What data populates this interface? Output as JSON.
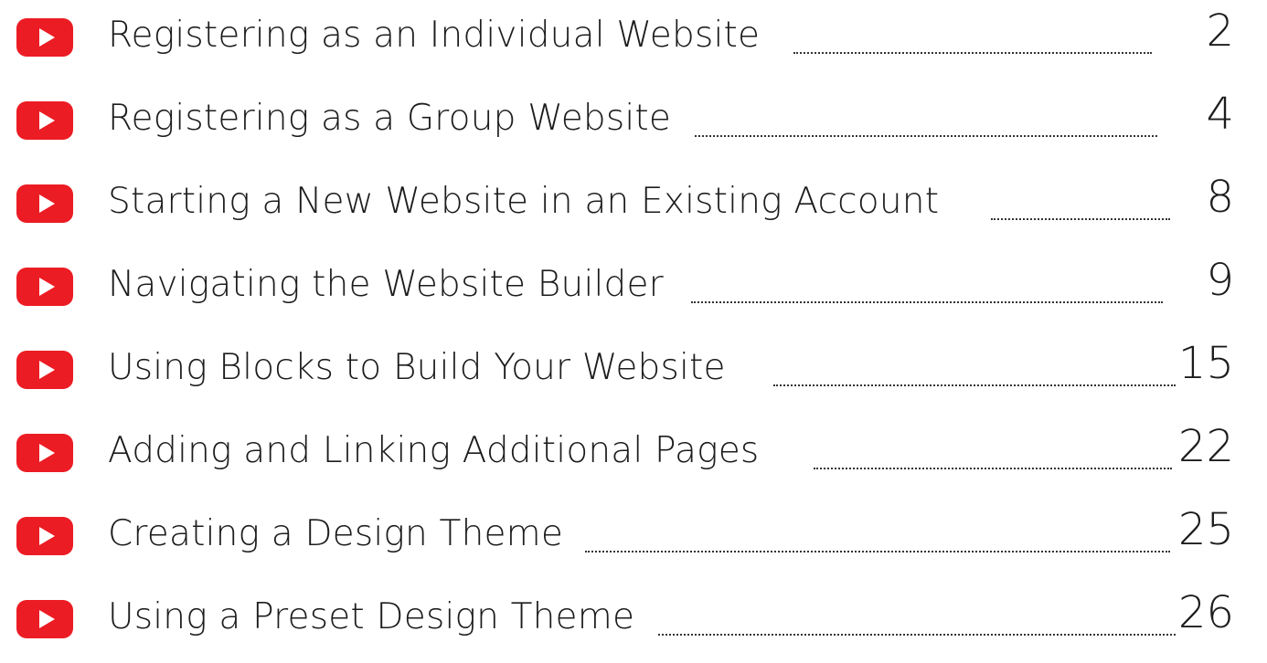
{
  "toc": {
    "entries": [
      {
        "title": "Registering as an Individual Website",
        "page": "2"
      },
      {
        "title": "Registering as a Group Website",
        "page": "4"
      },
      {
        "title": "Starting a New Website in an Existing Account",
        "page": "8"
      },
      {
        "title": "Navigating the Website Builder",
        "page": "9"
      },
      {
        "title": "Using Blocks to Build Your Website",
        "page": "15"
      },
      {
        "title": "Adding and Linking Additional Pages",
        "page": "22"
      },
      {
        "title": "Creating a Design Theme",
        "page": "25"
      },
      {
        "title": "Using a Preset Design Theme",
        "page": "26"
      }
    ],
    "icon": "video-play-icon",
    "icon_color": "#ec1c24"
  }
}
